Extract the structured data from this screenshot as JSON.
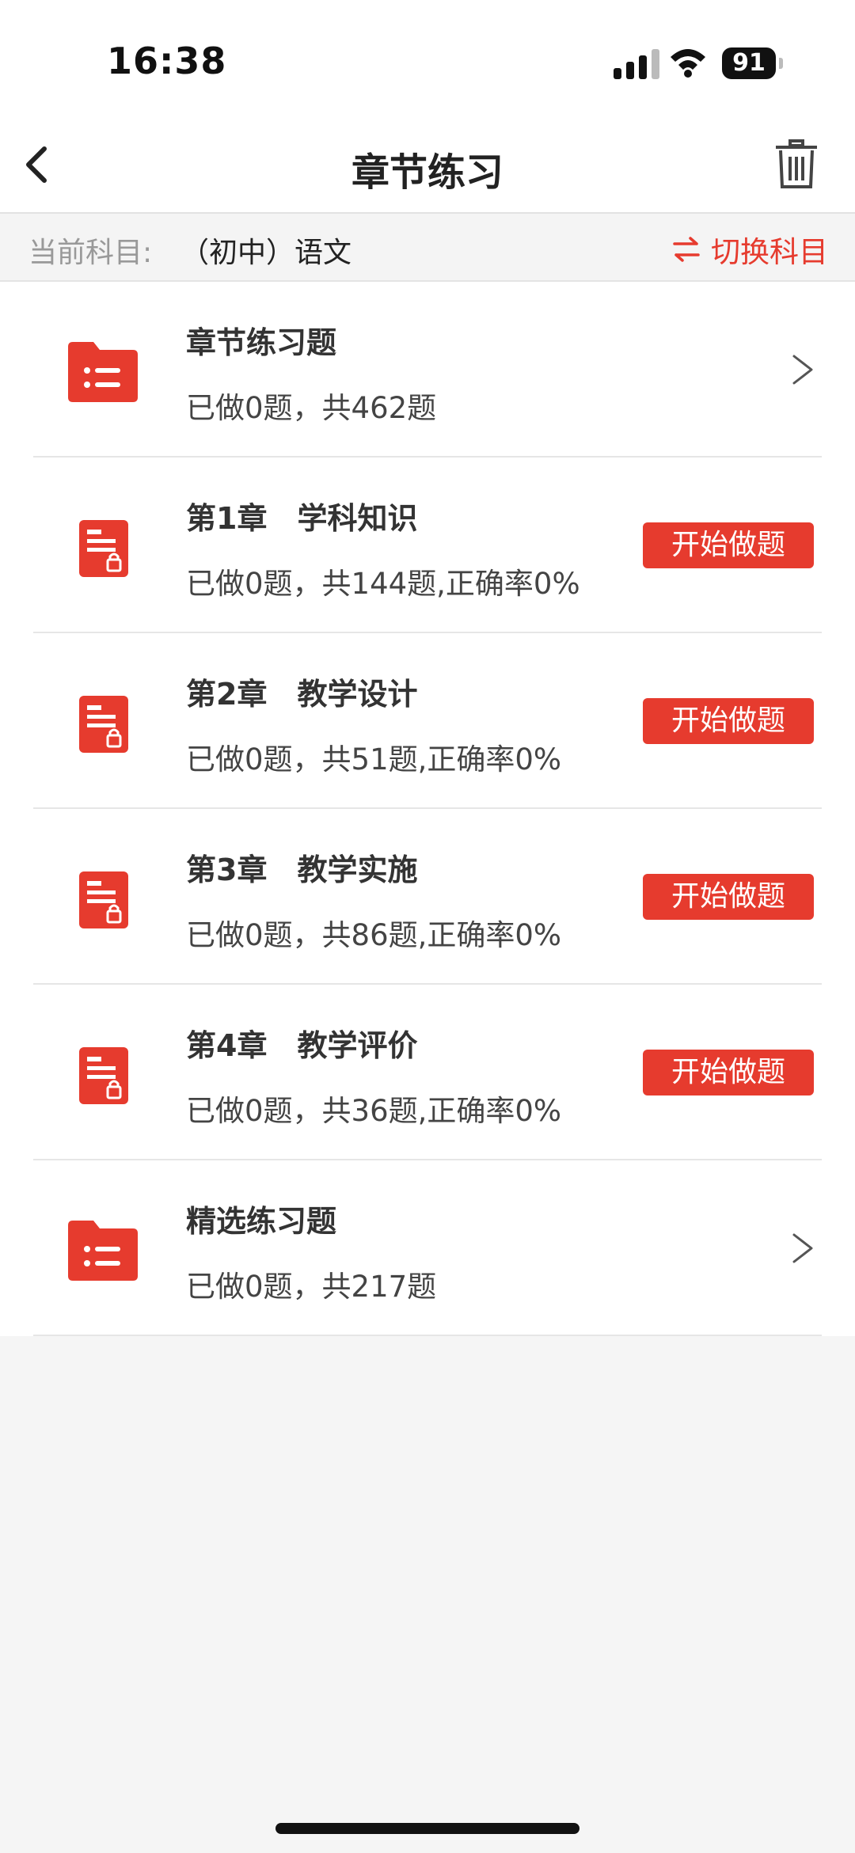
{
  "status_bar": {
    "time": "16:38",
    "battery": "91"
  },
  "nav": {
    "title": "章节练习",
    "back_icon": "chevron-left-icon",
    "trash_icon": "trash-icon"
  },
  "subject": {
    "label": "当前科目:",
    "value": "（初中）语文",
    "switch_label": "切换科目",
    "switch_icon": "swap-arrows-icon"
  },
  "colors": {
    "accent": "#e63b2e",
    "background": "#f5f5f5",
    "text": "#333333"
  },
  "list": {
    "items": [
      {
        "type": "folder",
        "icon": "folder-list-icon",
        "title": "章节练习题",
        "subtitle": "已做0题，共462题",
        "action": "chevron"
      },
      {
        "type": "chapter",
        "icon": "locked-document-icon",
        "title": "第1章　学科知识",
        "subtitle": "已做0题，共144题,正确率0%",
        "button": "开始做题"
      },
      {
        "type": "chapter",
        "icon": "locked-document-icon",
        "title": "第2章　教学设计",
        "subtitle": "已做0题，共51题,正确率0%",
        "button": "开始做题"
      },
      {
        "type": "chapter",
        "icon": "locked-document-icon",
        "title": "第3章　教学实施",
        "subtitle": "已做0题，共86题,正确率0%",
        "button": "开始做题"
      },
      {
        "type": "chapter",
        "icon": "locked-document-icon",
        "title": "第4章　教学评价",
        "subtitle": "已做0题，共36题,正确率0%",
        "button": "开始做题"
      },
      {
        "type": "folder",
        "icon": "folder-list-icon",
        "title": "精选练习题",
        "subtitle": "已做0题，共217题",
        "action": "chevron"
      }
    ]
  }
}
